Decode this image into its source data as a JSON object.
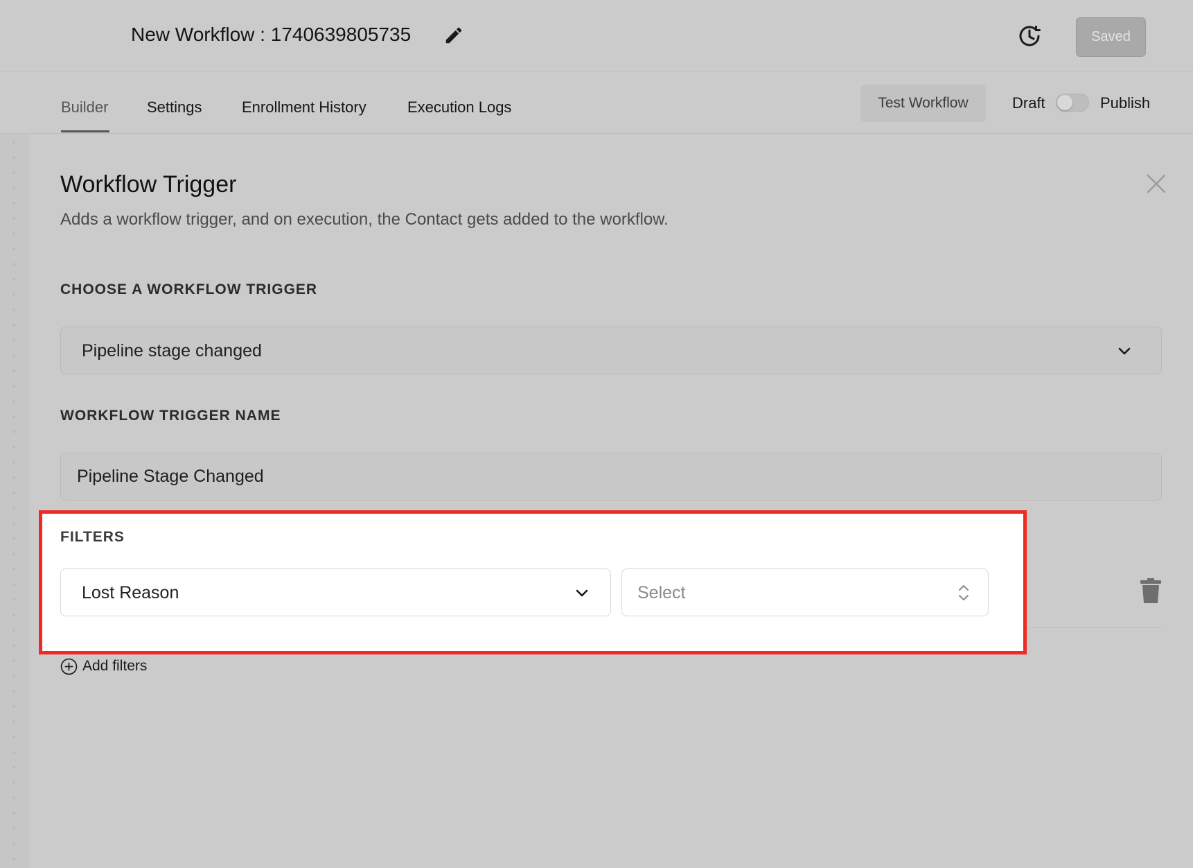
{
  "header": {
    "workflow_title": "New Workflow : 1740639805735",
    "saved_label": "Saved"
  },
  "tabs": [
    {
      "label": "Builder",
      "active": true
    },
    {
      "label": "Settings",
      "active": false
    },
    {
      "label": "Enrollment History",
      "active": false
    },
    {
      "label": "Execution Logs",
      "active": false
    }
  ],
  "actions": {
    "test_workflow_label": "Test Workflow",
    "draft_label": "Draft",
    "publish_label": "Publish",
    "published": false
  },
  "panel": {
    "title": "Workflow Trigger",
    "description": "Adds a workflow trigger, and on execution, the Contact gets added to the workflow.",
    "choose_trigger_label": "CHOOSE A WORKFLOW TRIGGER",
    "selected_trigger": "Pipeline stage changed",
    "trigger_name_label": "WORKFLOW TRIGGER NAME",
    "trigger_name_value": "Pipeline Stage Changed",
    "filters_label": "FILTERS",
    "filter_field": "Lost Reason",
    "filter_value_placeholder": "Select",
    "add_filters_label": "Add filters"
  },
  "icons": {
    "edit": "pencil-icon",
    "history": "history-icon",
    "close": "close-icon",
    "dropdown": "chevron-down-icon",
    "select": "updown-icon",
    "delete": "trash-icon",
    "add": "plus-circle-icon"
  },
  "colors": {
    "highlight_border": "#ee2b24",
    "background": "#cbcbcb",
    "saved_button": "#a9a9a9"
  }
}
